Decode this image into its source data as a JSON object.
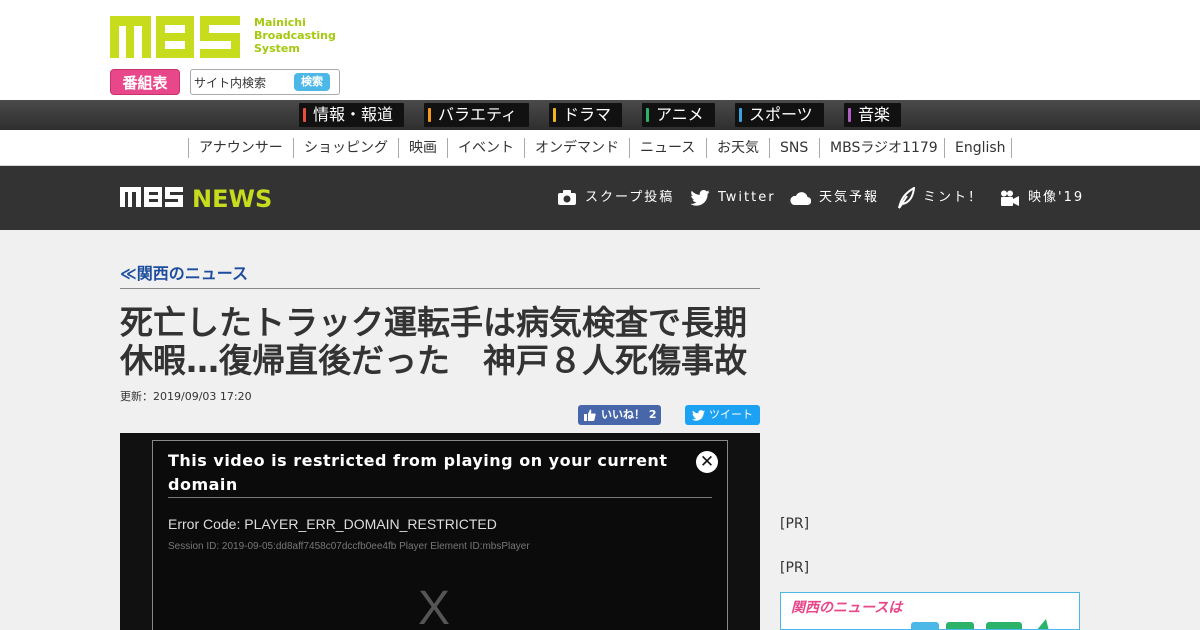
{
  "brand": {
    "logo_text": "MBS",
    "tagline_lines": [
      "Mainichi",
      "Broadcasting",
      "System"
    ],
    "accent_color": "#c7dc1d"
  },
  "header": {
    "tv_guide_label": "番組表",
    "search_value": "サイト内検索",
    "search_button": "検索"
  },
  "genres": [
    {
      "label": "情報・報道",
      "color": "#e8503c"
    },
    {
      "label": "バラエティ",
      "color": "#f39a1e"
    },
    {
      "label": "ドラマ",
      "color": "#f3b51e"
    },
    {
      "label": "アニメ",
      "color": "#2bb36a"
    },
    {
      "label": "スポーツ",
      "color": "#3ba3e0"
    },
    {
      "label": "音楽",
      "color": "#b25fc3"
    }
  ],
  "sub_nav": [
    "アナウンサー",
    "ショッピング",
    "映画",
    "イベント",
    "オンデマンド",
    "ニュース",
    "お天気",
    "SNS",
    "MBSラジオ1179",
    "English"
  ],
  "news_header": {
    "logo_mbs": "MBS",
    "logo_news": "NEWS",
    "links": [
      {
        "label": "スクープ投稿",
        "icon": "camera-icon"
      },
      {
        "label": "Twitter",
        "icon": "twitter-icon"
      },
      {
        "label": "天気予報",
        "icon": "cloud-icon"
      },
      {
        "label": "ミント！",
        "icon": "leaf-icon"
      },
      {
        "label": "映像'19",
        "icon": "video-camera-icon"
      }
    ]
  },
  "article": {
    "breadcrumb": "≪関西のニュース",
    "headline_line1": "死亡したトラック運転手は病気検査で長期",
    "headline_line2": "休暇…復帰直後だった　神戸８人死傷事故",
    "updated": "更新：2019/09/03 17:20",
    "like_label": "いいね！ 2",
    "tweet_label": "ツイート"
  },
  "player_error": {
    "title": "This video is restricted from playing on your current domain",
    "error_code": "Error Code: PLAYER_ERR_DOMAIN_RESTRICTED",
    "session": "Session ID: 2019-09-05:dd8aff7458c07dccfb0ee4fb Player Element ID:mbsPlayer",
    "close_symbol": "✕",
    "placeholder_symbol": "X"
  },
  "sidebar": {
    "pr_labels": [
      "[PR]",
      "[PR]"
    ],
    "banner_text": "関西のニュースは"
  }
}
